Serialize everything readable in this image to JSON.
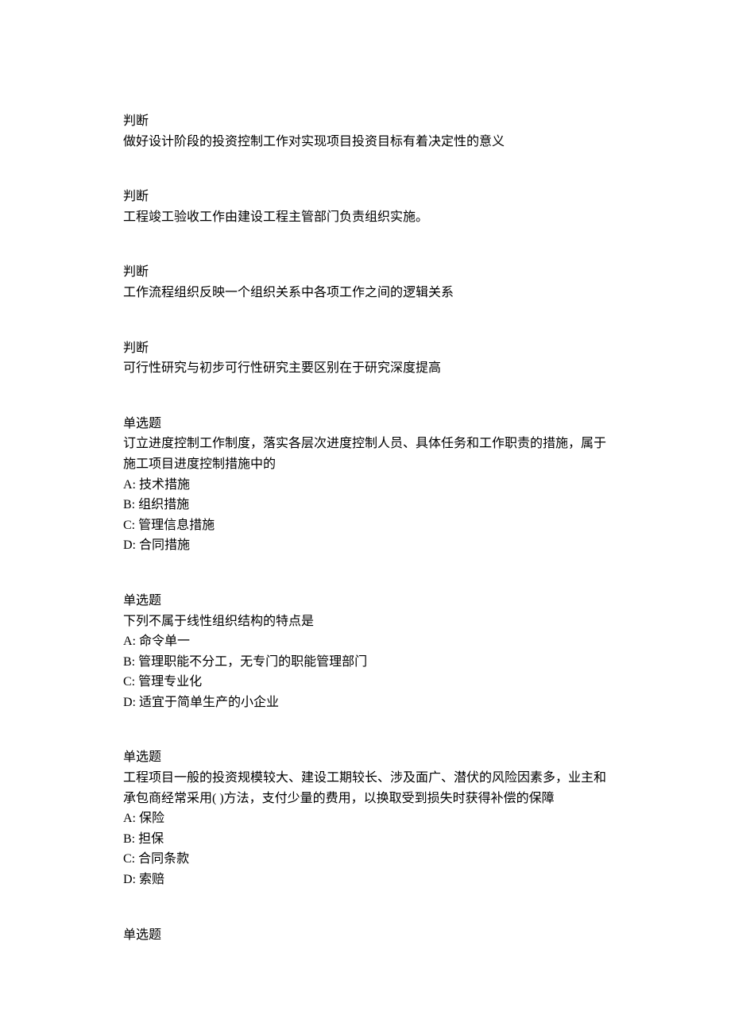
{
  "questions": [
    {
      "type": "判断",
      "text": "做好设计阶段的投资控制工作对实现项目投资目标有着决定性的意义",
      "options": []
    },
    {
      "type": "判断",
      "text": "工程竣工验收工作由建设工程主管部门负责组织实施。",
      "options": []
    },
    {
      "type": "判断",
      "text": "工作流程组织反映一个组织关系中各项工作之间的逻辑关系",
      "options": []
    },
    {
      "type": "判断",
      "text": "可行性研究与初步可行性研究主要区别在于研究深度提高",
      "options": []
    },
    {
      "type": "单选题",
      "text": "订立进度控制工作制度，落实各层次进度控制人员、具体任务和工作职责的措施，属于施工项目进度控制措施中的",
      "options": [
        "A:  技术措施",
        "B:  组织措施",
        "C:  管理信息措施",
        "D:  合同措施"
      ]
    },
    {
      "type": "单选题",
      "text": "下列不属于线性组织结构的特点是",
      "options": [
        "A:  命令单一",
        "B:  管理职能不分工，无专门的职能管理部门",
        "C:  管理专业化",
        "D:  适宜于简单生产的小企业"
      ]
    },
    {
      "type": "单选题",
      "text": "工程项目一般的投资规模较大、建设工期较长、涉及面广、潜伏的风险因素多，业主和承包商经常采用(     )方法，支付少量的费用，以换取受到损失时获得补偿的保障",
      "options": [
        "A:  保险",
        "B:  担保",
        "C:  合同条款",
        "D:  索赔"
      ]
    },
    {
      "type": "单选题",
      "text": "",
      "options": []
    }
  ]
}
